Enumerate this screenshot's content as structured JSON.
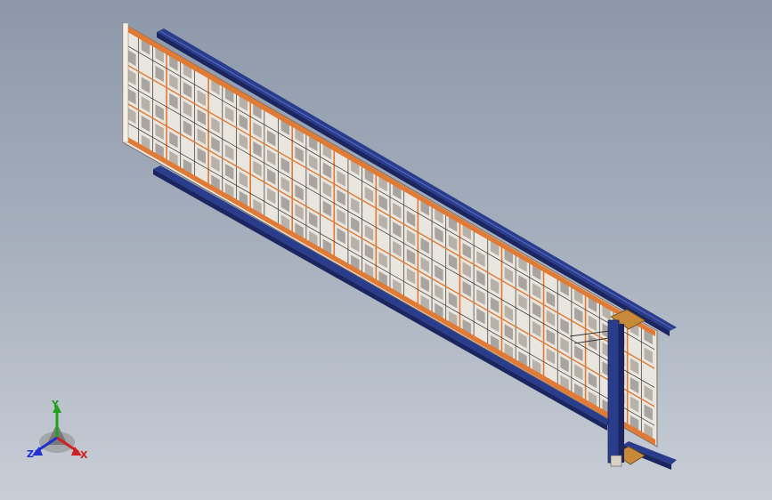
{
  "viewport": {
    "background_top": "#8c98aa",
    "background_bottom": "#c9ced6"
  },
  "model": {
    "frame_color": "#e07a35",
    "rail_color": "#2a3c8c",
    "panel_color": "#ece9e2",
    "mechanism_color": "#c88a3a"
  },
  "triad": {
    "x_label": "X",
    "y_label": "Y",
    "z_label": "Z",
    "x_color": "#d02020",
    "y_color": "#1fa31f",
    "z_color": "#2030d0"
  }
}
